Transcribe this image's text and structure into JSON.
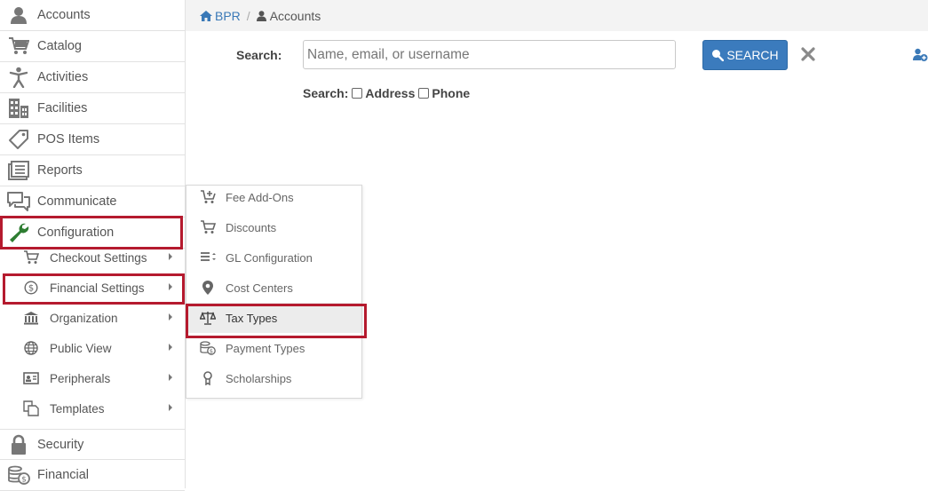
{
  "sidebar": {
    "items": [
      {
        "label": "Accounts",
        "icon": "user-icon"
      },
      {
        "label": "Catalog",
        "icon": "cart-icon"
      },
      {
        "label": "Activities",
        "icon": "person-activity-icon"
      },
      {
        "label": "Facilities",
        "icon": "building-icon"
      },
      {
        "label": "POS Items",
        "icon": "tag-icon"
      },
      {
        "label": "Reports",
        "icon": "reports-icon"
      },
      {
        "label": "Communicate",
        "icon": "chat-icon"
      },
      {
        "label": "Configuration",
        "icon": "wrench-icon"
      }
    ],
    "sub_items": [
      {
        "label": "Checkout Settings",
        "icon": "cart-icon"
      },
      {
        "label": "Financial Settings",
        "icon": "dollar-circle-icon"
      },
      {
        "label": "Organization",
        "icon": "institution-icon"
      },
      {
        "label": "Public View",
        "icon": "globe-icon"
      },
      {
        "label": "Peripherals",
        "icon": "id-card-icon"
      },
      {
        "label": "Templates",
        "icon": "copy-icon"
      }
    ],
    "bottom_items": [
      {
        "label": "Security",
        "icon": "lock-icon"
      },
      {
        "label": "Financial",
        "icon": "coins-icon"
      }
    ]
  },
  "breadcrumb": {
    "home": "BPR",
    "separator": "/",
    "current": "Accounts"
  },
  "search": {
    "label": "Search:",
    "placeholder": "Name, email, or username",
    "button_label": "SEARCH",
    "options_label": "Search:",
    "option_address": "Address",
    "option_phone": "Phone"
  },
  "flyout": {
    "items": [
      {
        "label": "Fee Add-Ons",
        "icon": "cart-plus-icon"
      },
      {
        "label": "Discounts",
        "icon": "cart-icon"
      },
      {
        "label": "GL Configuration",
        "icon": "list-sort-icon"
      },
      {
        "label": "Cost Centers",
        "icon": "map-marker-icon"
      },
      {
        "label": "Tax Types",
        "icon": "scale-icon"
      },
      {
        "label": "Payment Types",
        "icon": "money-icon"
      },
      {
        "label": "Scholarships",
        "icon": "award-icon"
      }
    ]
  },
  "colors": {
    "accent": "#3b7bbd",
    "highlight_border": "#b51a2e",
    "wrench": "#2e7d32"
  }
}
